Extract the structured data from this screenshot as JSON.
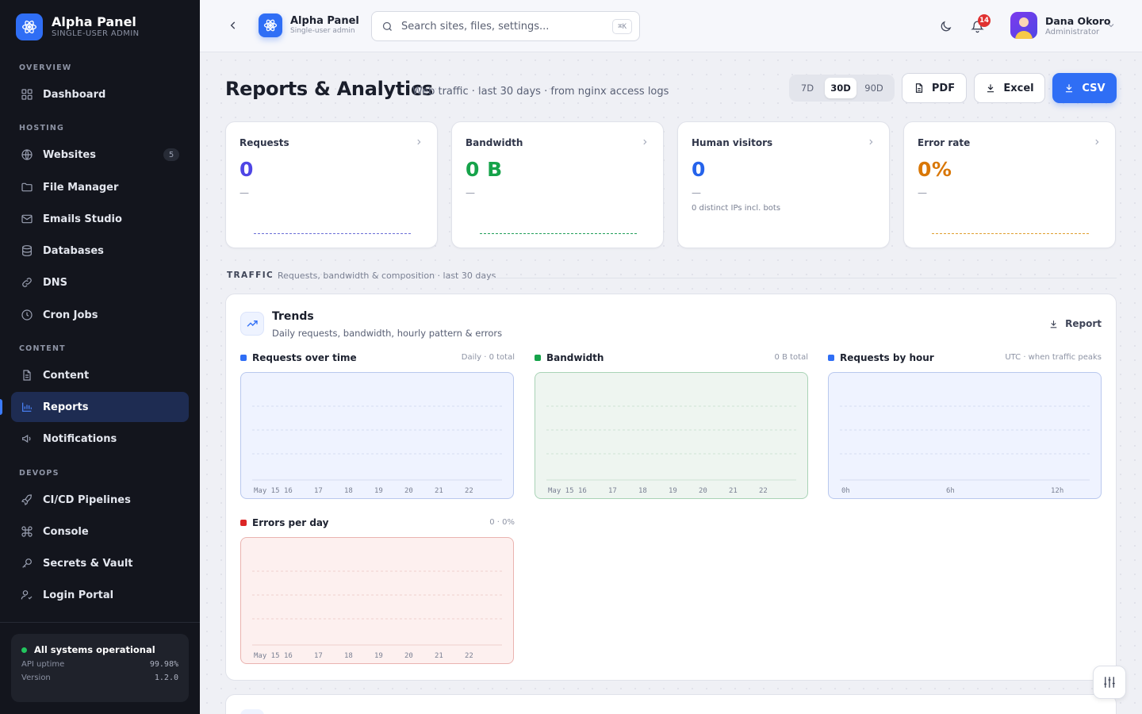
{
  "app": {
    "name": "Alpha Panel",
    "subtitle": "SINGLE-USER ADMIN"
  },
  "sidebar": {
    "sections": [
      {
        "label": "OVERVIEW"
      },
      {
        "label": "HOSTING"
      },
      {
        "label": "CONTENT"
      },
      {
        "label": "DEVOPS"
      }
    ],
    "items": [
      {
        "label": "Dashboard",
        "icon": "grid-icon"
      },
      {
        "label": "Websites",
        "icon": "globe-icon",
        "badge": "5"
      },
      {
        "label": "File Manager",
        "icon": "folder-icon"
      },
      {
        "label": "Emails Studio",
        "icon": "mail-icon"
      },
      {
        "label": "Databases",
        "icon": "database-icon"
      },
      {
        "label": "DNS",
        "icon": "link-icon"
      },
      {
        "label": "Cron Jobs",
        "icon": "clock-icon"
      },
      {
        "label": "Content",
        "icon": "document-icon"
      },
      {
        "label": "Reports",
        "icon": "bar-chart-icon",
        "active": true
      },
      {
        "label": "Notifications",
        "icon": "megaphone-icon"
      },
      {
        "label": "CI/CD Pipelines",
        "icon": "rocket-icon"
      },
      {
        "label": "Console",
        "icon": "command-icon"
      },
      {
        "label": "Secrets & Vault",
        "icon": "key-icon"
      },
      {
        "label": "Login Portal",
        "icon": "user-check-icon"
      }
    ],
    "status": {
      "title": "All systems operational",
      "uptime_label": "API uptime",
      "uptime_value": "99.98%",
      "version_label": "Version",
      "version_value": "1.2.0"
    }
  },
  "topbar": {
    "app_title": "Alpha Panel",
    "app_sub": "Single-user admin",
    "search_placeholder": "Search sites, files, settings...",
    "search_shortcut": "⌘K",
    "notification_count": "14",
    "user": {
      "name": "Dana Okoro",
      "role": "Administrator"
    }
  },
  "page": {
    "title": "Reports & Analytics",
    "subtitle": "Web traffic · last 30 days · from nginx access logs",
    "ranges": [
      "7D",
      "30D",
      "90D"
    ],
    "active_range": "30D",
    "export": {
      "pdf": "PDF",
      "excel": "Excel",
      "csv": "CSV"
    }
  },
  "stats": [
    {
      "label": "Requests",
      "value": "0",
      "delta": "—",
      "note": "",
      "color": "#4f46e5"
    },
    {
      "label": "Bandwidth",
      "value": "0 B",
      "delta": "—",
      "note": "",
      "color": "#16a34a"
    },
    {
      "label": "Human visitors",
      "value": "0",
      "delta": "—",
      "note": "0 distinct IPs incl. bots",
      "color": "#2563eb"
    },
    {
      "label": "Error rate",
      "value": "0%",
      "delta": "—",
      "note": "",
      "color": "#d97706"
    }
  ],
  "traffic": {
    "label": "TRAFFIC",
    "subtitle": "Requests, bandwidth & composition · last 30 days",
    "card": {
      "title": "Trends",
      "subtitle": "Daily requests, bandwidth, hourly pattern & errors",
      "report_label": "Report"
    },
    "panels": [
      {
        "title": "Requests over time",
        "meta": "Daily · 0 total",
        "color": "#2f6ef5",
        "ticks": [
          "May 15",
          "16",
          "17",
          "18",
          "19",
          "20",
          "21",
          "22"
        ]
      },
      {
        "title": "Bandwidth",
        "meta": "0 B total",
        "color": "#16a34a",
        "ticks": [
          "May 15",
          "16",
          "17",
          "18",
          "19",
          "20",
          "21",
          "22"
        ]
      },
      {
        "title": "Requests by hour",
        "meta": "UTC · when traffic peaks",
        "color": "#2f6ef5",
        "ticks": [
          "0h",
          "6h",
          "12h"
        ]
      },
      {
        "title": "Errors per day",
        "meta": "0 · 0%",
        "color": "#dc2626",
        "ticks": [
          "May 15",
          "16",
          "17",
          "18",
          "19",
          "20",
          "21",
          "22"
        ]
      }
    ]
  }
}
